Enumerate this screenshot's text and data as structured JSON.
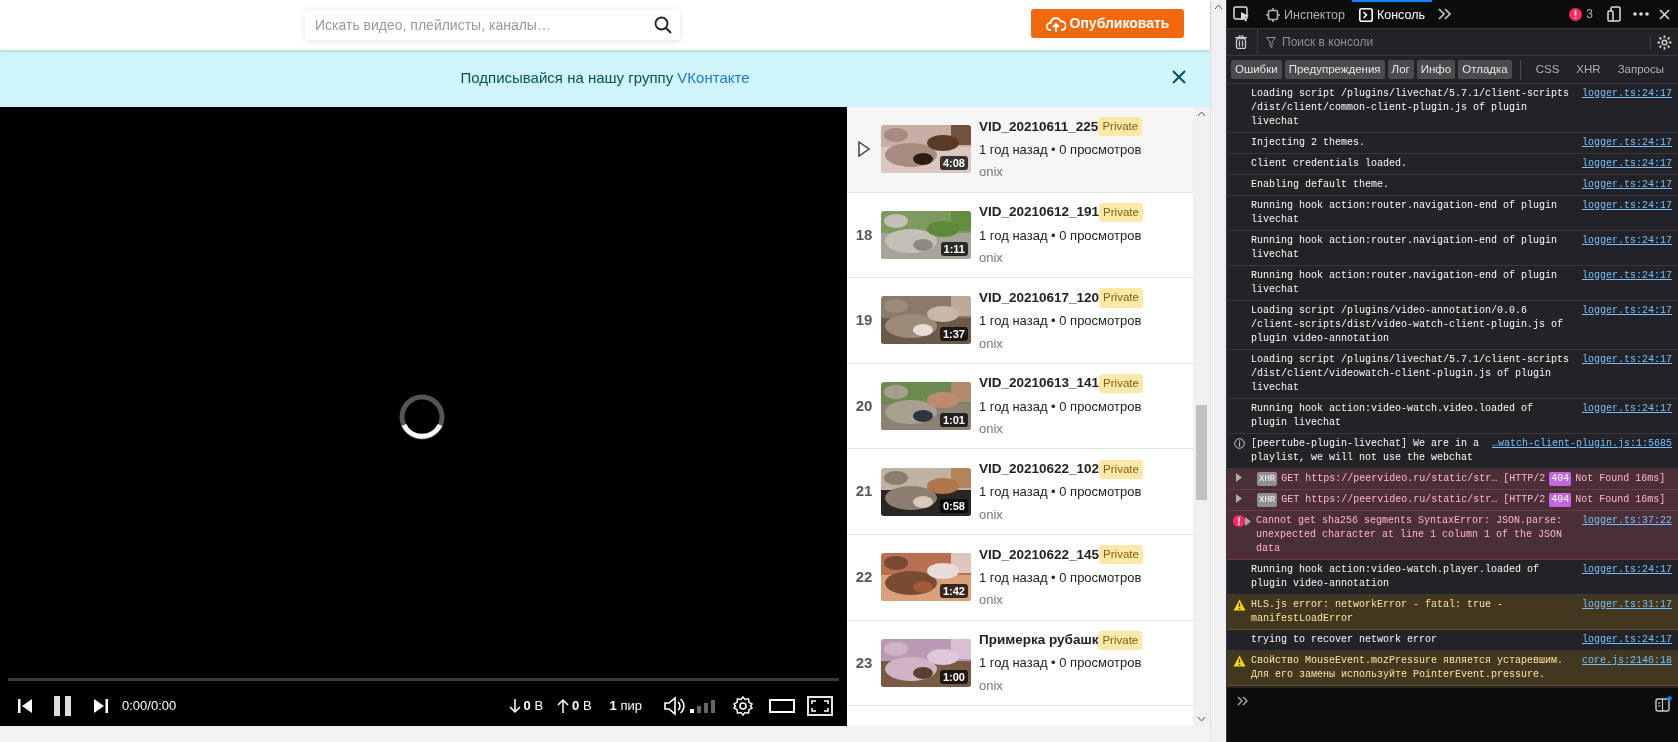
{
  "header": {
    "search": {
      "placeholder": "Искать видео, плейлисты, каналы…"
    },
    "publish_button": {
      "label": "Опубликовать"
    }
  },
  "banner": {
    "text": "Подписывайся на нашу группу ",
    "link": "VКонтакте"
  },
  "player": {
    "loading": true,
    "playing": true,
    "progress": {
      "level": 0
    },
    "time": "0:00/0:00",
    "download": "**0** B",
    "upload": "**0** B",
    "peers": "**1** пир",
    "volume": {
      "level": 0.25
    }
  },
  "playlist": {
    "items": [
      {
        "selected": true,
        "title": "VID_20210611_225",
        "badge": "Private",
        "meta": "1 год назад • 0 просмотров",
        "channel": "onix",
        "duration": "4:08"
      },
      {
        "selected": false,
        "index": "18",
        "title": "VID_20210612_191",
        "badge": "Private",
        "meta": "1 год назад • 0 просмотров",
        "channel": "onix",
        "duration": "1:11"
      },
      {
        "selected": false,
        "index": "19",
        "title": "VID_20210617_120",
        "badge": "Private",
        "meta": "1 год назад • 0 просмотров",
        "channel": "onix",
        "duration": "1:37"
      },
      {
        "selected": false,
        "index": "20",
        "title": "VID_20210613_141",
        "badge": "Private",
        "meta": "1 год назад • 0 просмотров",
        "channel": "onix",
        "duration": "1:01"
      },
      {
        "selected": false,
        "index": "21",
        "title": "VID_20210622_102",
        "badge": "Private",
        "meta": "1 год назад • 0 просмотров",
        "channel": "onix",
        "duration": "0:58"
      },
      {
        "selected": false,
        "index": "22",
        "title": "VID_20210622_145",
        "badge": "Private",
        "meta": "1 год назад • 0 просмотров",
        "channel": "onix",
        "duration": "1:42"
      },
      {
        "selected": false,
        "index": "23",
        "title": "Примерка рубашк",
        "badge": "Private",
        "meta": "1 год назад • 0 просмотров",
        "channel": "onix",
        "duration": "1:00"
      }
    ]
  },
  "devtools": {
    "tabs": [
      {
        "kind": "inspector",
        "label": "Инспектор",
        "selected": false
      },
      {
        "kind": "console",
        "label": "Консоль",
        "selected": true
      }
    ],
    "error_count": "3",
    "search": {
      "placeholder": "Поиск в консоли"
    },
    "filters": [
      {
        "label": "Ошибки",
        "on": true
      },
      {
        "label": "Предупреждения",
        "on": true
      },
      {
        "label": "Лог",
        "on": true
      },
      {
        "label": "Инфо",
        "on": true
      },
      {
        "label": "Отладка",
        "on": true
      },
      {
        "label": "CSS",
        "on": false
      },
      {
        "label": "XHR",
        "on": false
      },
      {
        "label": "Запросы",
        "on": false
      }
    ],
    "messages": [
      {
        "kind": "log",
        "text": "Loading script /plugins/livechat/5.7.1/client-scripts /dist/client/common-client-plugin.js of plugin livechat",
        "source": "logger.ts:24:17"
      },
      {
        "kind": "log",
        "text": "Injecting 2 themes.",
        "source": "logger.ts:24:17"
      },
      {
        "kind": "log",
        "text": "Client credentials loaded.",
        "source": "logger.ts:24:17"
      },
      {
        "kind": "log",
        "text": "Enabling default theme.",
        "source": "logger.ts:24:17"
      },
      {
        "kind": "log",
        "text": "Running hook action:router.navigation-end of plugin livechat",
        "source": "logger.ts:24:17"
      },
      {
        "kind": "log",
        "text": "Running hook action:router.navigation-end of plugin livechat",
        "source": "logger.ts:24:17"
      },
      {
        "kind": "log",
        "text": "Running hook action:router.navigation-end of plugin livechat",
        "source": "logger.ts:24:17"
      },
      {
        "kind": "log",
        "text": "Loading script /plugins/video-annotation/0.0.6 /client-scripts/dist/video-watch-client-plugin.js of plugin video-annotation",
        "source": "logger.ts:24:17"
      },
      {
        "kind": "log",
        "text": "Loading script /plugins/livechat/5.7.1/client-scripts /dist/client/videowatch-client-plugin.js of plugin livechat",
        "source": "logger.ts:24:17"
      },
      {
        "kind": "log",
        "text": "Running hook action:video-watch.video.loaded of plugin livechat",
        "source": "logger.ts:24:17"
      },
      {
        "kind": "info",
        "text": "[peertube-plugin-livechat] We are in a playlist, we will not use the webchat",
        "source": "…watch-client-plugin.js:1:5685"
      },
      {
        "kind": "xhr",
        "badge": "XHR",
        "method": "GET",
        "url": "https://peervideo.ru/static/str…",
        "protocol": "[HTTP/2",
        "status": "404",
        "status_text": "Not Found 16ms]"
      },
      {
        "kind": "xhr",
        "badge": "XHR",
        "method": "GET",
        "url": "https://peervideo.ru/static/str…",
        "protocol": "[HTTP/2",
        "status": "404",
        "status_text": "Not Found 16ms]"
      },
      {
        "kind": "error",
        "text": "Cannot get sha256 segments SyntaxError: JSON.parse: unexpected character at line 1 column 1 of the JSON data",
        "source": "logger.ts:37:22"
      },
      {
        "kind": "log",
        "text": "Running hook action:video-watch.player.loaded of plugin video-annotation",
        "source": "logger.ts:24:17"
      },
      {
        "kind": "warning",
        "text": "HLS.js error: networkError - fatal: true - manifestLoadError",
        "source": "logger.ts:31:17"
      },
      {
        "kind": "log",
        "text": "trying to recover network error",
        "source": "logger.ts:24:17"
      },
      {
        "kind": "warning",
        "text": "Свойство MouseEvent.mozPressure является устаревшим. Для его замены используйте PointerEvent.pressure.",
        "source": "core.js:2146:18"
      }
    ]
  }
}
